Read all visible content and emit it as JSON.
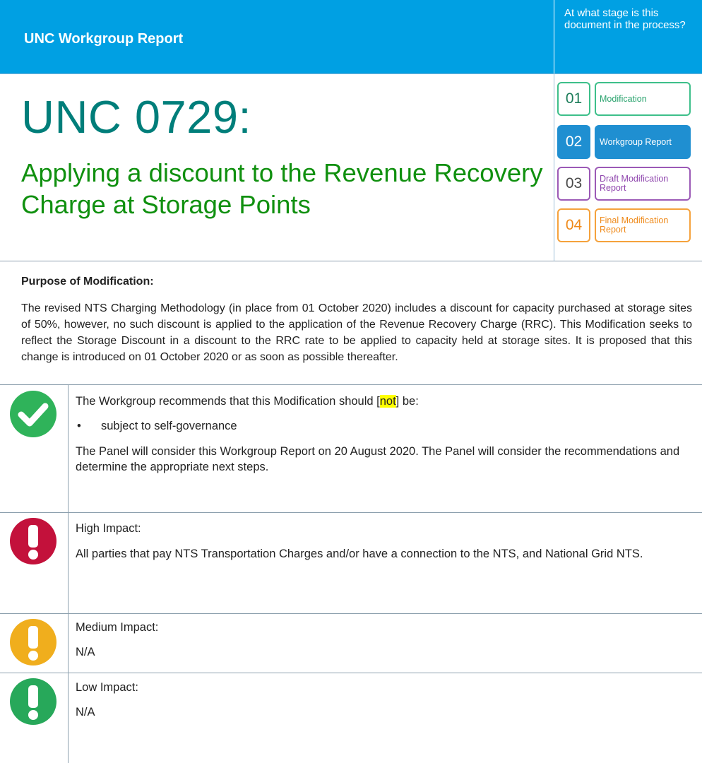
{
  "header": {
    "title": "UNC Workgroup Report",
    "stage_question": "At what stage is this document in the process?"
  },
  "modification": {
    "number": "UNC 0729:",
    "title": "Applying a discount to the Revenue Recovery Charge at Storage Points"
  },
  "stages": [
    {
      "num": "01",
      "label": "Modification"
    },
    {
      "num": "02",
      "label": "Workgroup Report"
    },
    {
      "num": "03",
      "label": "Draft Modification Report"
    },
    {
      "num": "04",
      "label": "Final Modification Report"
    }
  ],
  "purpose": {
    "heading": "Purpose of Modification:",
    "text": "The revised NTS Charging Methodology (in place from 01 October 2020) includes a discount for capacity purchased at storage sites of 50%, however, no such discount is applied to the application of the Revenue Recovery Charge (RRC).  This Modification seeks to reflect the Storage Discount in a discount to the RRC rate to be applied to capacity held at storage sites. It is proposed that this change is introduced on 01 October 2020 or as soon as possible thereafter."
  },
  "recommendation": {
    "line_before": "The Workgroup recommends that this Modification should [",
    "highlight": "not",
    "line_after": "] be:",
    "bullet": "subject to self-governance",
    "panel_text": "The Panel will consider this Workgroup Report on 20 August 2020. The Panel will consider the recommendations and determine the appropriate next steps."
  },
  "impacts": {
    "high": {
      "label": "High Impact:",
      "text": "All parties that pay NTS Transportation Charges and/or have a connection to the NTS, and National Grid NTS."
    },
    "medium": {
      "label": "Medium Impact:",
      "text": "N/A"
    },
    "low": {
      "label": "Low Impact:",
      "text": "N/A"
    }
  },
  "colors": {
    "header_blue": "#00a0e3",
    "number_teal": "#007e7a",
    "title_green": "#10900f"
  }
}
